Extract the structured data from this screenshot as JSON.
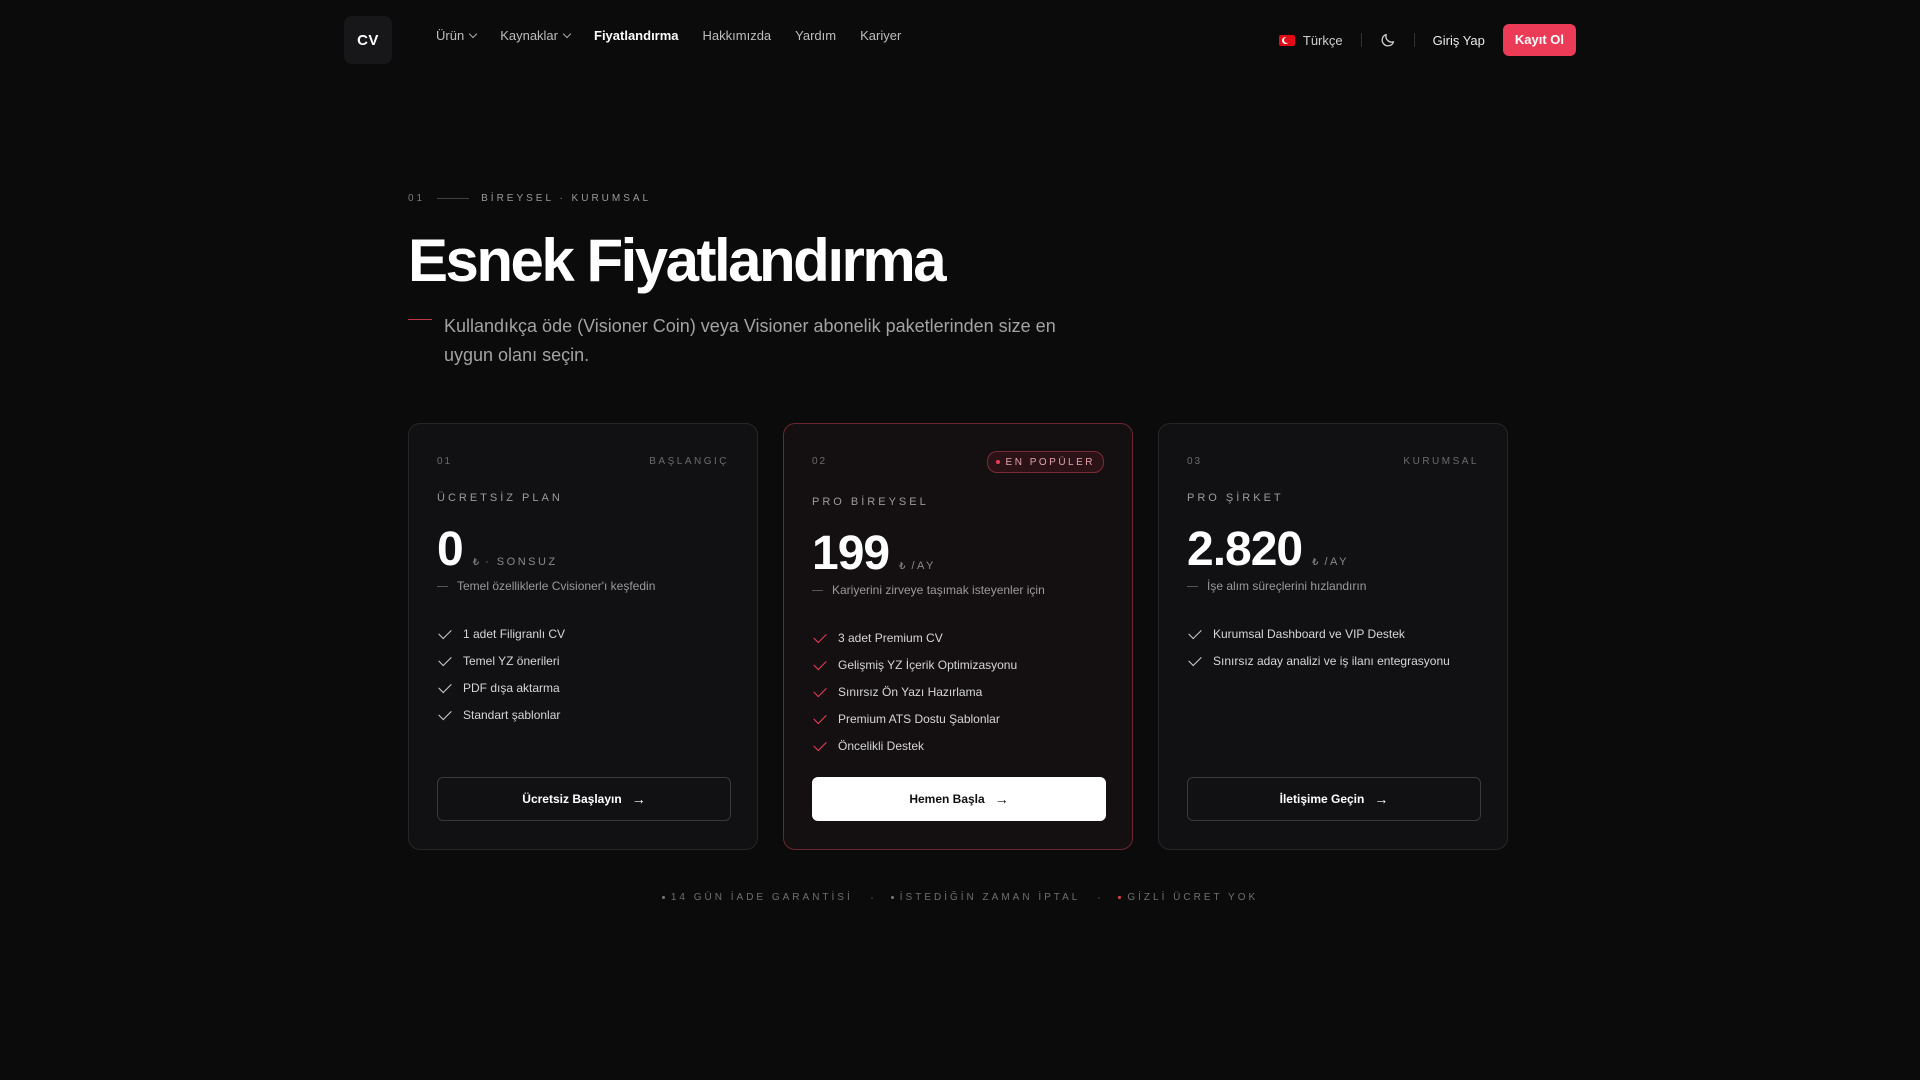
{
  "nav": {
    "logo": "CV",
    "links": [
      {
        "label": "Ürün",
        "dropdown": true
      },
      {
        "label": "Kaynaklar",
        "dropdown": true
      },
      {
        "label": "Fiyatlandırma",
        "active": true
      },
      {
        "label": "Hakkımızda"
      },
      {
        "label": "Yardım"
      },
      {
        "label": "Kariyer"
      }
    ],
    "language": "Türkçe",
    "login": "Giriş Yap",
    "signup": "Kayıt Ol"
  },
  "hero": {
    "eyebrow_num": "01",
    "eyebrow_tags": "BİREYSEL · KURUMSAL",
    "title": "Esnek Fiyatlandırma",
    "subtitle": "Kullandıkça öde (Visioner Coin) veya Visioner abonelik paketlerinden size en uygun olanı seçin."
  },
  "plans": [
    {
      "num": "01",
      "tag": "BAŞLANGIÇ",
      "name": "ÜCRETSİZ PLAN",
      "price": "0",
      "currency": "₺",
      "period": "· SONSUZ",
      "desc": "Temel özelliklerle Cvisioner'ı keşfedin",
      "features": [
        "1 adet Filigranlı CV",
        "Temel YZ önerileri",
        "PDF dışa aktarma",
        "Standart şablonlar"
      ],
      "cta": "Ücretsiz Başlayın"
    },
    {
      "num": "02",
      "badge": "EN POPÜLER",
      "name": "PRO BİREYSEL",
      "price": "199",
      "currency": "₺",
      "period": "/AY",
      "desc": "Kariyerini zirveye taşımak isteyenler için",
      "features": [
        "3 adet Premium CV",
        "Gelişmiş YZ İçerik Optimizasyonu",
        "Sınırsız Ön Yazı Hazırlama",
        "Premium ATS Dostu Şablonlar",
        "Öncelikli Destek"
      ],
      "cta": "Hemen Başla"
    },
    {
      "num": "03",
      "tag": "KURUMSAL",
      "name": "PRO ŞİRKET",
      "price": "2.820",
      "currency": "₺",
      "period": "/AY",
      "desc": "İşe alım süreçlerini hızlandırın",
      "features": [
        "Kurumsal Dashboard ve VIP Destek",
        "Sınırsız aday analizi ve iş ilanı entegrasyonu"
      ],
      "cta": "İletişime Geçin"
    }
  ],
  "notes": [
    "14 GÜN İADE GARANTİSİ",
    "İSTEDİĞİN ZAMAN İPTAL",
    "GİZLİ ÜCRET YOK"
  ],
  "colors": {
    "accent": "#ec3b57",
    "background": "#0b0b0c",
    "card": "#111113"
  },
  "icons": {
    "language": "turkey-flag-icon",
    "theme": "moon-icon",
    "check": "check-icon",
    "arrow": "arrow-right-icon"
  }
}
